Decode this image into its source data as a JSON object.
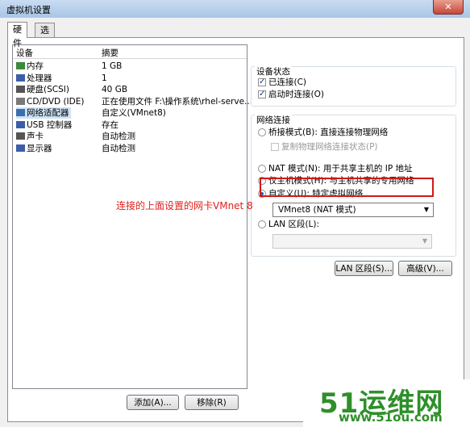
{
  "window": {
    "title": "虚拟机设置",
    "close_label": "✕"
  },
  "tabs": [
    {
      "label": "硬件"
    },
    {
      "label": "选项"
    }
  ],
  "device_list": {
    "col_device": "设备",
    "col_summary": "摘要",
    "rows": [
      {
        "name": "内存",
        "summary": "1 GB",
        "icon": "memory-icon",
        "color": "#3c8a3c"
      },
      {
        "name": "处理器",
        "summary": "1",
        "icon": "processor-icon",
        "color": "#3a5fa8"
      },
      {
        "name": "硬盘(SCSI)",
        "summary": "40 GB",
        "icon": "hard-disk-icon",
        "color": "#555555"
      },
      {
        "name": "CD/DVD (IDE)",
        "summary": "正在使用文件 F:\\操作系统\\rhel-serve...",
        "icon": "cd-dvd-icon",
        "color": "#7a7a7a"
      },
      {
        "name": "网络适配器",
        "summary": "自定义(VMnet8)",
        "icon": "network-adapter-icon",
        "color": "#3a6fb0",
        "selected": true
      },
      {
        "name": "USB 控制器",
        "summary": "存在",
        "icon": "usb-icon",
        "color": "#3a5fa8"
      },
      {
        "name": "声卡",
        "summary": "自动检测",
        "icon": "sound-card-icon",
        "color": "#555555"
      },
      {
        "name": "显示器",
        "summary": "自动检测",
        "icon": "display-icon",
        "color": "#3a5fa8"
      }
    ]
  },
  "buttons": {
    "add": "添加(A)...",
    "remove": "移除(R)",
    "lan_segments": "LAN 区段(S)...",
    "advanced": "高级(V)..."
  },
  "device_status": {
    "title": "设备状态",
    "connected": "已连接(C)",
    "connect_at_power_on": "启动时连接(O)"
  },
  "network_connection": {
    "title": "网络连接",
    "bridged": "桥接模式(B): 直接连接物理网络",
    "replicate_state": "复制物理网络连接状态(P)",
    "nat": "NAT 模式(N): 用于共享主机的 IP 地址",
    "host_only": "仅主机模式(H): 与主机共享的专用网络",
    "custom": "自定义(U): 特定虚拟网络",
    "custom_selected_value": "VMnet8 (NAT 模式)",
    "lan_segment": "LAN 区段(L):",
    "lan_segment_value": ""
  },
  "annotation": "连接的上面设置的网卡VMnet 8",
  "watermark": {
    "main": "51运维网",
    "url": "www.51ou.com"
  },
  "colors": {
    "annotation": "#e0201b",
    "watermark": "#2f8f2a",
    "highlight": "#d01818"
  }
}
